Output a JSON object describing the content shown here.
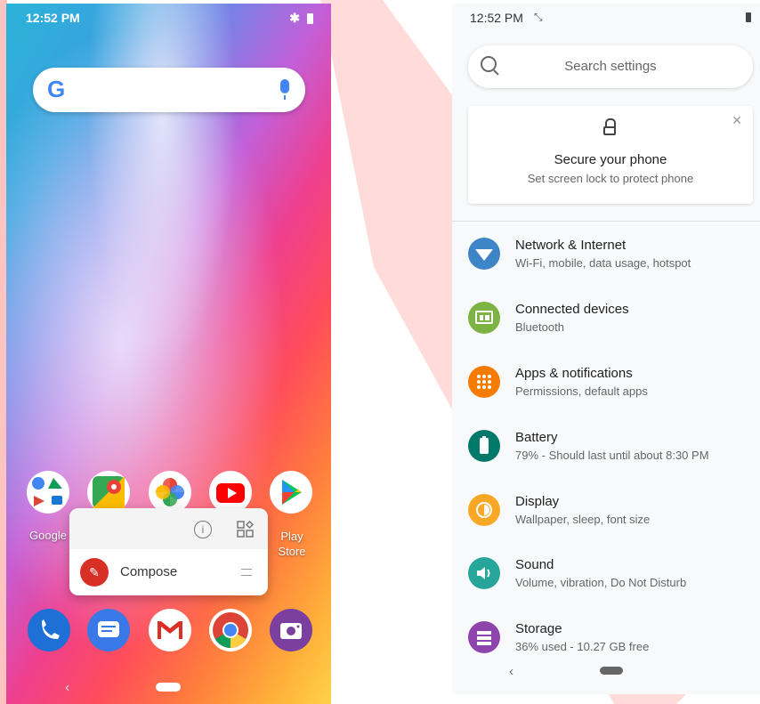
{
  "left_phone": {
    "status": {
      "time": "12:52 PM"
    },
    "search": {
      "google_glyph": "G"
    },
    "apps": [
      {
        "label": "Google"
      },
      {
        "label": "Play\nStore"
      }
    ],
    "popup": {
      "compose_label": "Compose"
    }
  },
  "right_phone": {
    "status": {
      "time": "12:52 PM"
    },
    "search": {
      "placeholder": "Search settings"
    },
    "secure_card": {
      "title": "Secure your phone",
      "subtitle": "Set screen lock to protect phone"
    },
    "settings": [
      {
        "title": "Network & Internet",
        "subtitle": "Wi-Fi, mobile, data usage, hotspot",
        "color": "#3d85c6",
        "icon": "wifi-icon"
      },
      {
        "title": "Connected devices",
        "subtitle": "Bluetooth",
        "color": "#7cb342",
        "icon": "devices-icon"
      },
      {
        "title": "Apps & notifications",
        "subtitle": "Permissions, default apps",
        "color": "#f57c00",
        "icon": "apps-icon"
      },
      {
        "title": "Battery",
        "subtitle": "79% - Should last until about 8:30 PM",
        "color": "#00796b",
        "icon": "battery-icon"
      },
      {
        "title": "Display",
        "subtitle": "Wallpaper, sleep, font size",
        "color": "#f9a825",
        "icon": "display-icon"
      },
      {
        "title": "Sound",
        "subtitle": "Volume, vibration, Do Not Disturb",
        "color": "#26a69a",
        "icon": "sound-icon"
      },
      {
        "title": "Storage",
        "subtitle": "36% used - 10.27 GB free",
        "color": "#8e44ad",
        "icon": "storage-icon"
      }
    ]
  }
}
